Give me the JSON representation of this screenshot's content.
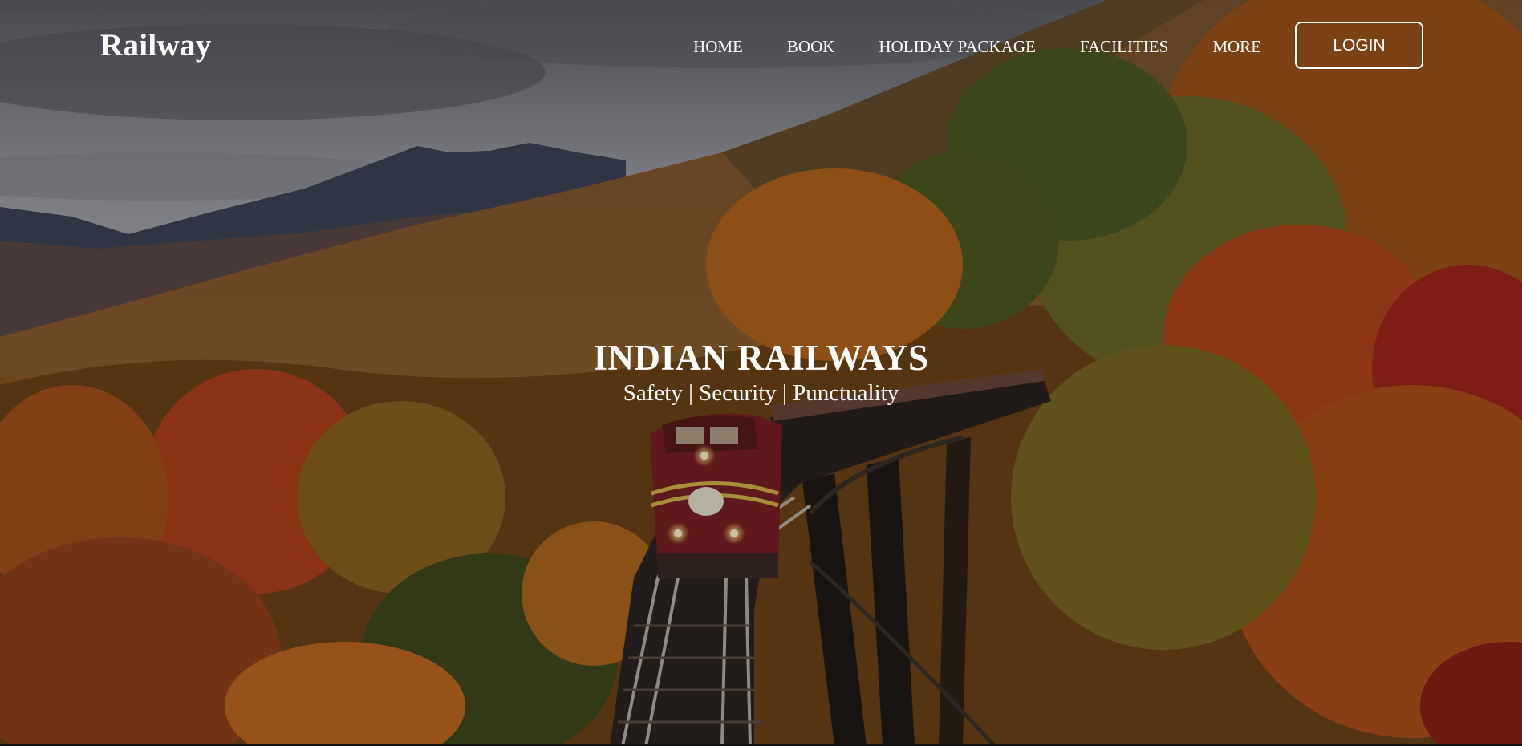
{
  "brand": {
    "name": "Railway"
  },
  "nav": {
    "items": [
      {
        "label": "HOME"
      },
      {
        "label": "BOOK"
      },
      {
        "label": "HOLIDAY PACKAGE"
      },
      {
        "label": "FACILITIES"
      },
      {
        "label": "MORE"
      }
    ],
    "login_label": "LOGIN"
  },
  "hero": {
    "title": "INDIAN RAILWAYS",
    "tagline": "Safety | Security | Punctuality"
  },
  "colors": {
    "text": "#ffffff",
    "sky": "#8a8c92",
    "mountain": "#3f4658",
    "foliage_orange": "#c1591c",
    "foliage_red": "#a5271a",
    "foliage_green": "#5a5a24",
    "train_red": "#7a1f24"
  }
}
